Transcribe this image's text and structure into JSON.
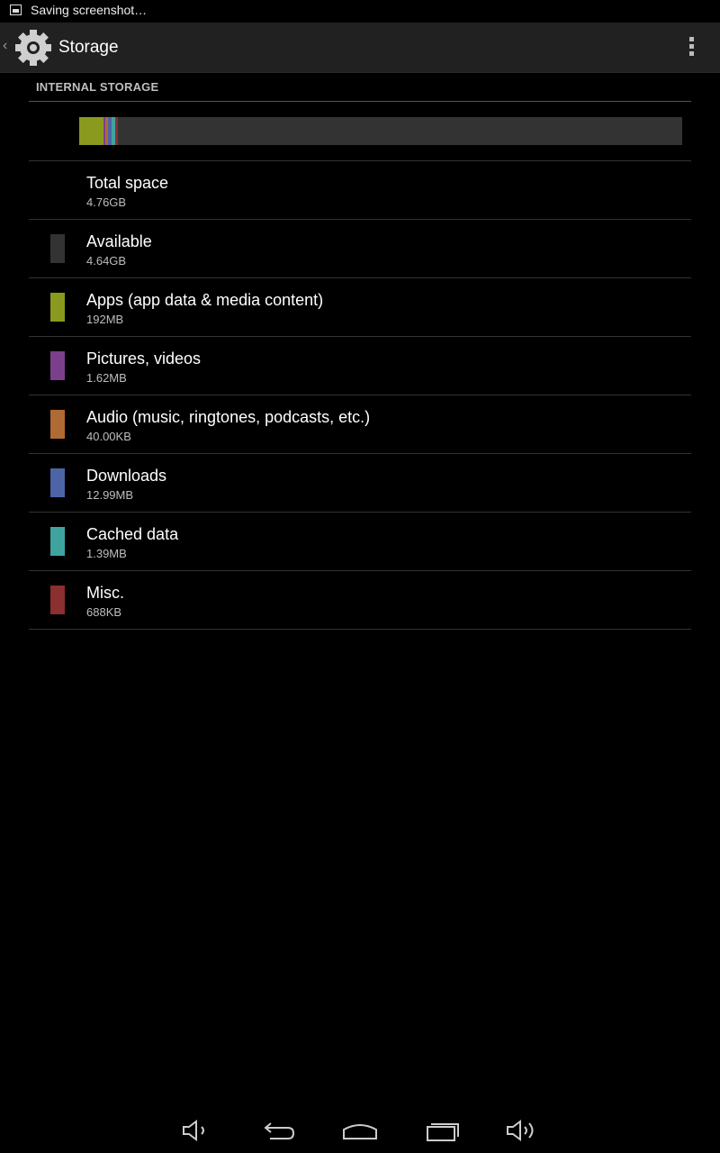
{
  "status": {
    "text": "Saving screenshot…"
  },
  "action_bar": {
    "title": "Storage"
  },
  "section": {
    "header": "INTERNAL STORAGE"
  },
  "usage_bar": {
    "segments": [
      {
        "name": "apps",
        "fraction": 0.04,
        "color": "#8a9a1e"
      },
      {
        "name": "pictures",
        "fraction": 0.004,
        "color": "#7b3f8c"
      },
      {
        "name": "audio",
        "fraction": 0.004,
        "color": "#b06a34"
      },
      {
        "name": "downloads",
        "fraction": 0.006,
        "color": "#4d65a6"
      },
      {
        "name": "cached",
        "fraction": 0.006,
        "color": "#3fa3a0"
      },
      {
        "name": "misc",
        "fraction": 0.004,
        "color": "#8b2f2f"
      }
    ],
    "track_color": "#333333"
  },
  "rows": [
    {
      "title": "Total space",
      "value": "4.76GB",
      "color": ""
    },
    {
      "title": "Available",
      "value": "4.64GB",
      "color": "#333333"
    },
    {
      "title": "Apps (app data & media content)",
      "value": "192MB",
      "color": "#8a9a1e"
    },
    {
      "title": "Pictures, videos",
      "value": "1.62MB",
      "color": "#7b3f8c"
    },
    {
      "title": "Audio (music, ringtones, podcasts, etc.)",
      "value": "40.00KB",
      "color": "#b06a34"
    },
    {
      "title": "Downloads",
      "value": "12.99MB",
      "color": "#4d65a6"
    },
    {
      "title": "Cached data",
      "value": "1.39MB",
      "color": "#3fa3a0"
    },
    {
      "title": "Misc.",
      "value": "688KB",
      "color": "#8b2f2f"
    }
  ],
  "nav": {
    "buttons": [
      "volume-down-icon",
      "back-icon",
      "home-icon",
      "recents-icon",
      "volume-up-icon"
    ]
  }
}
